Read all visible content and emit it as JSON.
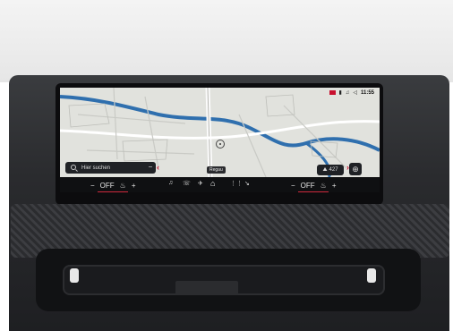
{
  "status": {
    "time": "11:55"
  },
  "search": {
    "placeholder": "Hier suchen",
    "minus": "−"
  },
  "map": {
    "position_label": "Regau",
    "gps_label": "427",
    "poi_symbol": "⊕"
  },
  "climate": {
    "left": {
      "minus": "−",
      "value": "OFF",
      "plus": "+"
    },
    "right": {
      "minus": "−",
      "value": "OFF",
      "plus": "+"
    }
  },
  "bottom_icons": [
    "♫",
    "☏",
    "✈",
    "⌂",
    "⋮⋮",
    "↘"
  ]
}
